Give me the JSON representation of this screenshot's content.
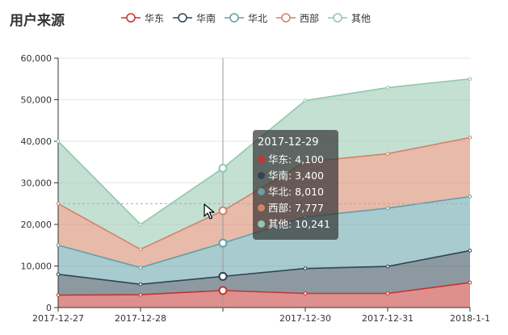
{
  "chart_data": {
    "type": "area",
    "stacked": true,
    "title": "用户来源",
    "categories": [
      "2017-12-27",
      "2017-12-28",
      "2017-12-29",
      "2017-12-30",
      "2017-12-31",
      "2018-1-1"
    ],
    "series": [
      {
        "name": "华东",
        "values": [
          3000,
          3100,
          4100,
          3400,
          3400,
          6000
        ],
        "color": "#c23531"
      },
      {
        "name": "华南",
        "values": [
          5000,
          2500,
          3400,
          6000,
          6500,
          7700
        ],
        "color": "#2f4554"
      },
      {
        "name": "华北",
        "values": [
          7000,
          4000,
          8010,
          12400,
          14000,
          13000
        ],
        "color": "#61a0a8"
      },
      {
        "name": "西部",
        "values": [
          10000,
          4400,
          7777,
          13200,
          13100,
          14200
        ],
        "color": "#d48265"
      },
      {
        "name": "其他",
        "values": [
          15000,
          6000,
          10241,
          14800,
          15900,
          14100
        ],
        "color": "#91c7ae"
      }
    ],
    "ylim": [
      0,
      60000
    ],
    "yticks": [
      "0",
      "10,000",
      "20,000",
      "30,000",
      "40,000",
      "50,000",
      "60,000"
    ],
    "xtick_labels": [
      "2017-12-27",
      "2017-12-28",
      "",
      "2017-12-30",
      "2017-12-31",
      "2018-1-1"
    ],
    "grid": true,
    "legend": "top",
    "axis_pointer_index": 2
  },
  "tooltip": {
    "date": "2017-12-29",
    "rows": [
      {
        "label": "华东: 4,100",
        "color": "#c23531"
      },
      {
        "label": "华南: 3,400",
        "color": "#2f4554"
      },
      {
        "label": "华北: 8,010",
        "color": "#61a0a8"
      },
      {
        "label": "西部: 7,777",
        "color": "#d48265"
      },
      {
        "label": "其他: 10,241",
        "color": "#91c7ae"
      }
    ]
  }
}
